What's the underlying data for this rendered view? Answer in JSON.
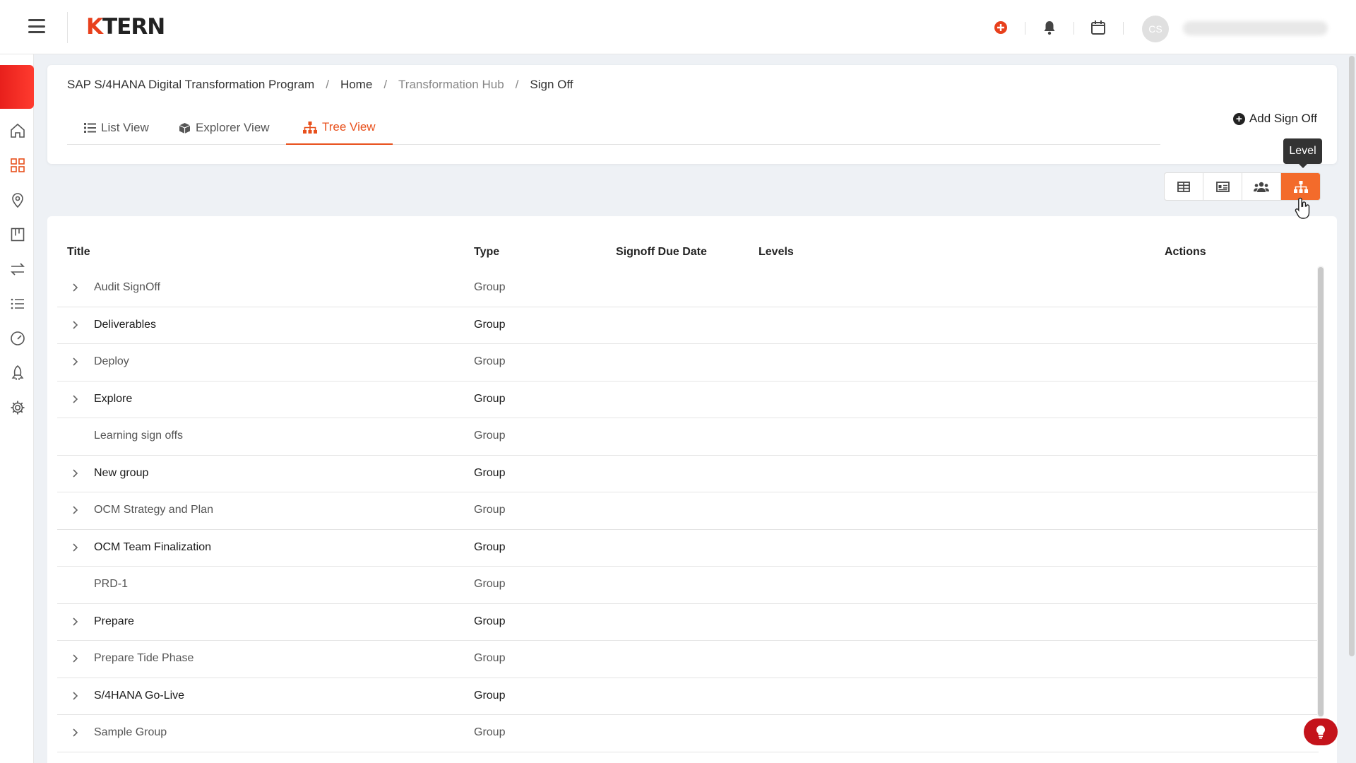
{
  "app": {
    "logo_text_k": "K",
    "logo_text_rest": "TERN",
    "avatar_initials": "CS",
    "accent_color": "#e8501c",
    "brand_red": "#e8201c"
  },
  "breadcrumb": {
    "program": "SAP S/4HANA Digital Transformation Program",
    "home": "Home",
    "hub": "Transformation Hub",
    "current": "Sign Off",
    "separator": "/"
  },
  "tabs": {
    "list_view": "List View",
    "explorer_view": "Explorer View",
    "tree_view": "Tree View"
  },
  "actions": {
    "add_signoff": "Add Sign Off",
    "tooltip_level": "Level"
  },
  "table": {
    "headers": {
      "title": "Title",
      "type": "Type",
      "due_date": "Signoff Due Date",
      "levels": "Levels",
      "actions": "Actions"
    },
    "rows": [
      {
        "title": "Audit SignOff",
        "type": "Group"
      },
      {
        "title": "Deliverables",
        "type": "Group"
      },
      {
        "title": "Deploy",
        "type": "Group"
      },
      {
        "title": "Explore",
        "type": "Group"
      },
      {
        "title": "Learning sign offs",
        "type": "Group"
      },
      {
        "title": "New group",
        "type": "Group"
      },
      {
        "title": "OCM Strategy and Plan",
        "type": "Group"
      },
      {
        "title": "OCM Team Finalization",
        "type": "Group"
      },
      {
        "title": "PRD-1",
        "type": "Group"
      },
      {
        "title": "Prepare",
        "type": "Group"
      },
      {
        "title": "Prepare Tide Phase",
        "type": "Group"
      },
      {
        "title": "S/4HANA Go-Live",
        "type": "Group"
      },
      {
        "title": "Sample Group",
        "type": "Group"
      }
    ]
  }
}
